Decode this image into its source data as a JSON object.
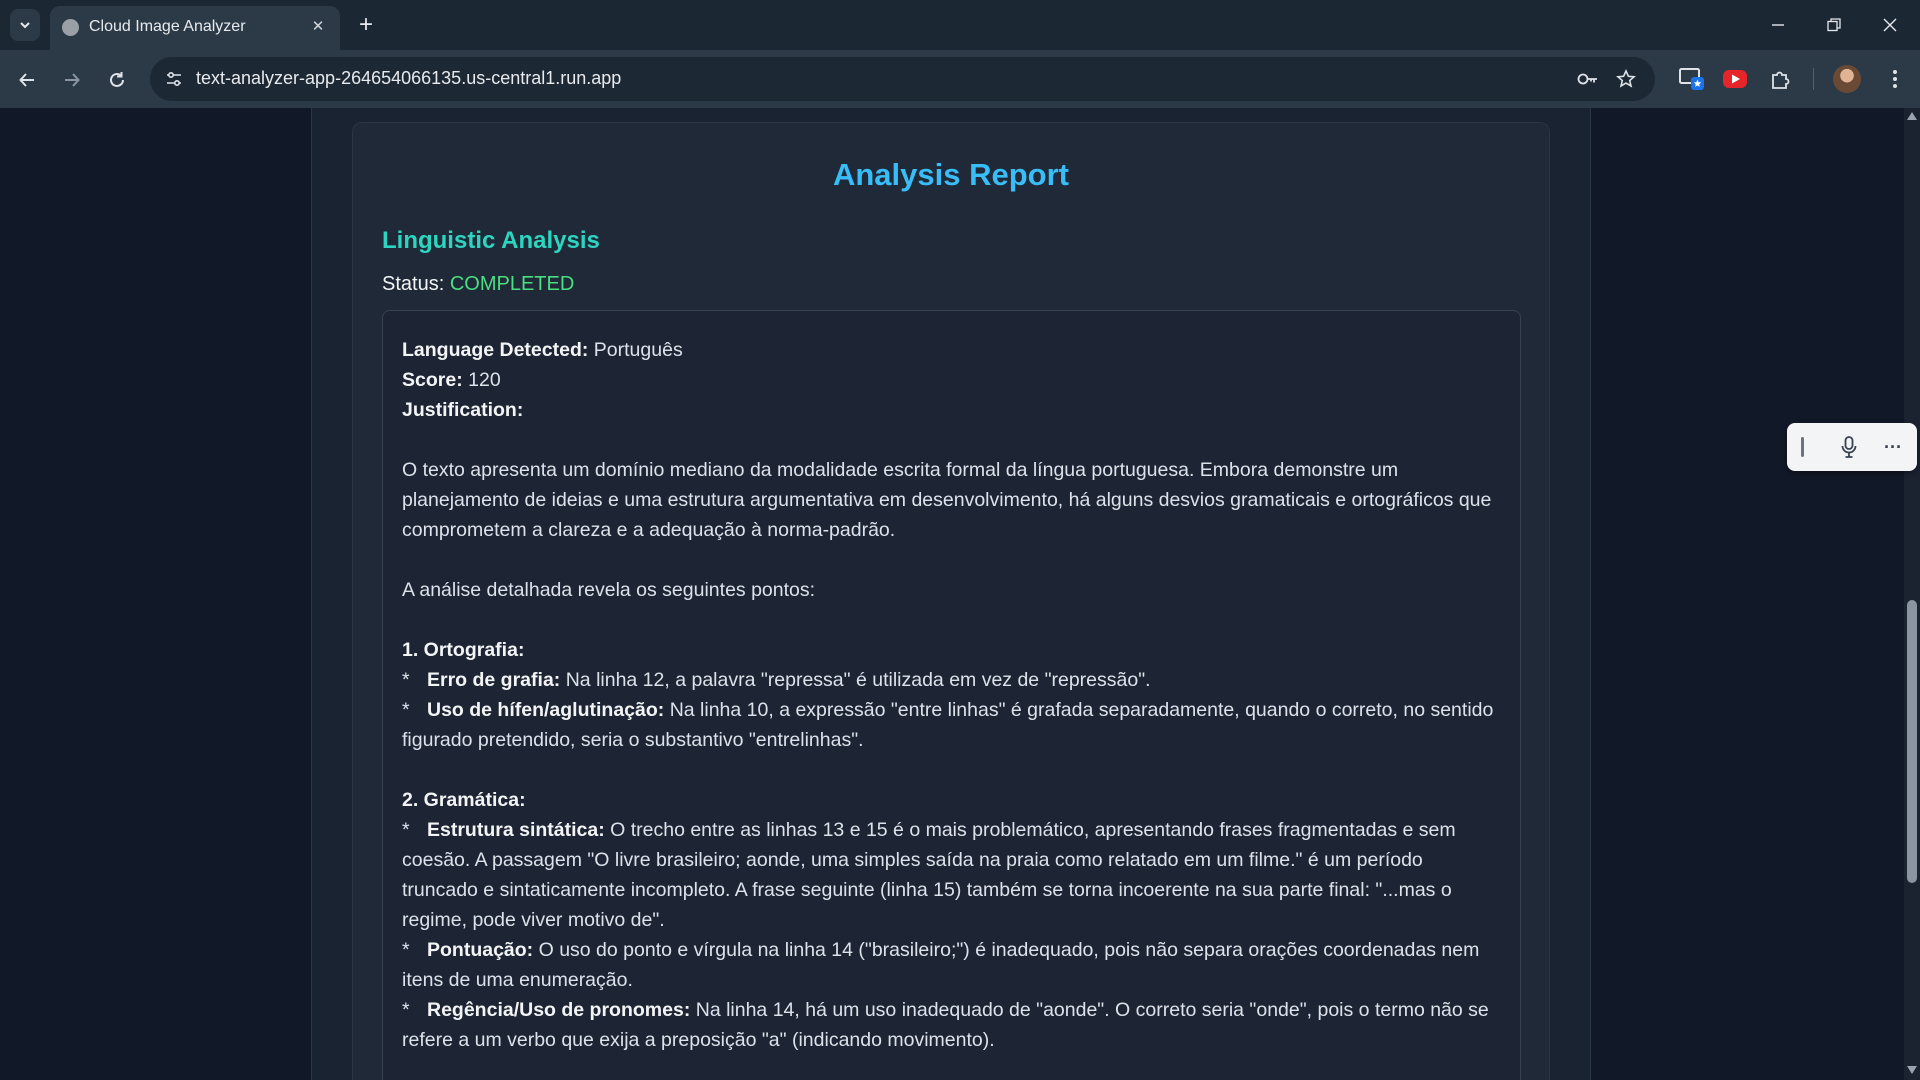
{
  "browser": {
    "tab_title": "Cloud Image Analyzer",
    "tab_close_glyph": "✕",
    "new_tab_glyph": "+",
    "url": "text-analyzer-app-264654066135.us-central1.run.app",
    "icons": {
      "tab_list": "chevron-down-icon",
      "back": "arrow-left-icon",
      "forward": "arrow-right-icon",
      "reload": "reload-icon",
      "site_info": "tune-icon",
      "password": "key-icon",
      "bookmark": "star-icon",
      "extensions": [
        "cast-icon",
        "youtube-icon",
        "puzzle-icon"
      ],
      "menu": "kebab-menu-icon",
      "window": [
        "minimize-icon",
        "restore-icon",
        "close-icon"
      ]
    }
  },
  "report": {
    "title": "Analysis Report",
    "section_title": "Linguistic Analysis",
    "status_label": "Status:",
    "status_value": "COMPLETED",
    "colors": {
      "title": "#38bdf8",
      "section": "#2dd4bf",
      "status": "#4ade80"
    },
    "result": {
      "language_label": "Language Detected:",
      "language_value": "Português",
      "score_label": "Score:",
      "score_value": "120",
      "justification_label": "Justification:",
      "intro": "O texto apresenta um domínio mediano da modalidade escrita formal da língua portuguesa. Embora demonstre um planejamento de ideias e uma estrutura argumentativa em desenvolvimento, há alguns desvios gramaticais e ortográficos que comprometem a clareza e a adequação à norma-padrão.",
      "detail_intro": "A análise detalhada revela os seguintes pontos:",
      "sections": [
        {
          "heading": "1. Ortografia:",
          "items": [
            {
              "label": "Erro de grafia:",
              "text": "Na linha 12, a palavra \"repressa\" é utilizada em vez de \"repressão\"."
            },
            {
              "label": "Uso de hífen/aglutinação:",
              "text": "Na linha 10, a expressão \"entre linhas\" é grafada separadamente, quando o correto, no sentido figurado pretendido, seria o substantivo \"entrelinhas\"."
            }
          ]
        },
        {
          "heading": "2. Gramática:",
          "items": [
            {
              "label": "Estrutura sintática:",
              "text": "O trecho entre as linhas 13 e 15 é o mais problemático, apresentando frases fragmentadas e sem coesão. A passagem \"O livre brasileiro; aonde, uma simples saída na praia como relatado em um filme.\" é um período truncado e sintaticamente incompleto. A frase seguinte (linha 15) também se torna incoerente na sua parte final: \"...mas o regime, pode viver motivo de\"."
            },
            {
              "label": "Pontuação:",
              "text": "O uso do ponto e vírgula na linha 14 (\"brasileiro;\") é inadequado, pois não separa orações coordenadas nem itens de uma enumeração."
            },
            {
              "label": "Regência/Uso de pronomes:",
              "text": "Na linha 14, há um uso inadequado de \"aonde\". O correto seria \"onde\", pois o termo não se refere a um verbo que exija a preposição \"a\" (indicando movimento)."
            }
          ]
        }
      ]
    }
  },
  "voice_widget": {
    "icons": [
      "drag-handle-icon",
      "microphone-icon",
      "more-icon"
    ],
    "more_glyph": "···"
  }
}
